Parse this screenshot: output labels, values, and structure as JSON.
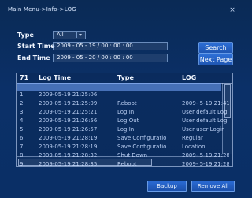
{
  "window": {
    "title": "Main Menu->Info->LOG"
  },
  "filters": {
    "type_label": "Type",
    "type_value": "All",
    "start_label": "Start Time",
    "start_value": "2009 - 05 - 19 / 00 : 00 : 00",
    "end_label": "End Time",
    "end_value": "2009 - 05 - 20 / 00 : 00 : 00"
  },
  "actions": {
    "search_label": "Search",
    "next_page_label": "Next Page"
  },
  "table": {
    "headers": {
      "num": "71",
      "time": "Log Time",
      "type": "Type",
      "log": "LOG"
    },
    "rows": [
      {
        "num": "1",
        "time": "2009-05-19 21:25:06",
        "type": "",
        "log": ""
      },
      {
        "num": "2",
        "time": "2009-05-19 21:25:09",
        "type": "Reboot",
        "log": "2009- 5-19 21:41"
      },
      {
        "num": "3",
        "time": "2009-05-19 21:25:21",
        "type": "Log In",
        "log": "User default Log"
      },
      {
        "num": "4",
        "time": "2009-05-19 21:26:56",
        "type": "Log Out",
        "log": "User default Log"
      },
      {
        "num": "5",
        "time": "2009-05-19 21:26:57",
        "type": "Log In",
        "log": "User user Login"
      },
      {
        "num": "6",
        "time": "2009-05-19 21:28:19",
        "type": "Save Configuratio",
        "log": "Regular"
      },
      {
        "num": "7",
        "time": "2009-05-19 21:28:19",
        "type": "Save Configuratio",
        "log": "Location"
      },
      {
        "num": "8",
        "time": "2009-05-19 21:28:32",
        "type": "Shut Down",
        "log": "2009- 5-19 21:28"
      },
      {
        "num": "9",
        "time": "2009-05-19 21:28:35",
        "type": "Reboot",
        "log": "2009- 5-19 21:28"
      }
    ]
  },
  "footer": {
    "backup_label": "Backup",
    "remove_label": "Remove All"
  },
  "colors": {
    "background": "#0b3068",
    "selection": "#78aaff"
  },
  "icons": {
    "close": "close-icon",
    "dropdown": "chevron-down-icon"
  }
}
